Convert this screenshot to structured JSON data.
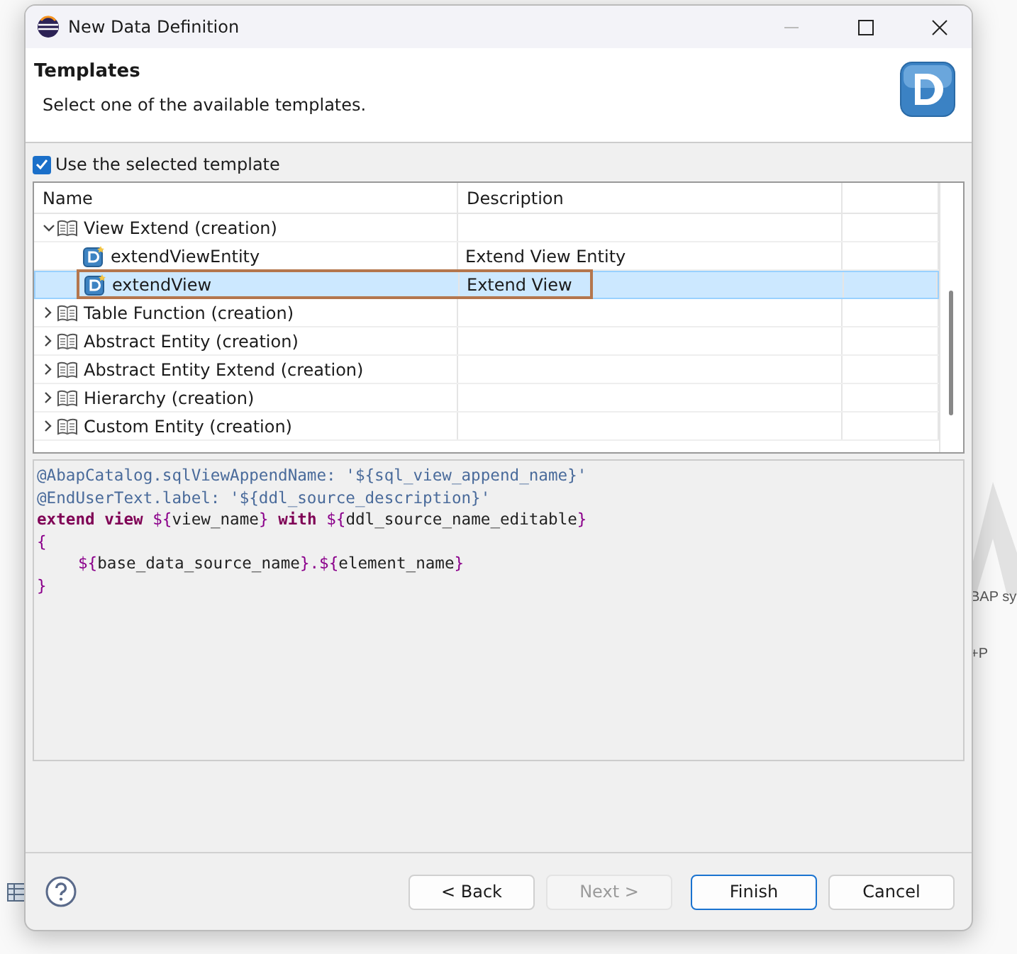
{
  "background": {
    "texts": [
      "BAP sy",
      "+P"
    ]
  },
  "window": {
    "title": "New Data Definition"
  },
  "header": {
    "title": "Templates",
    "description": "Select one of the available templates."
  },
  "use_template": {
    "label": "Use the selected template",
    "checked": true
  },
  "table": {
    "columns": [
      "Name",
      "Description"
    ],
    "rows": [
      {
        "kind": "folder",
        "name": "View Extend (creation)",
        "expanded": true,
        "selected": false,
        "children": [
          {
            "kind": "template",
            "name": "extendViewEntity",
            "description": "Extend View Entity",
            "selected": false,
            "boxed": false
          },
          {
            "kind": "template",
            "name": "extendView",
            "description": "Extend View",
            "selected": true,
            "boxed": true
          }
        ]
      },
      {
        "kind": "folder",
        "name": "Table Function (creation)",
        "expanded": false,
        "selected": false
      },
      {
        "kind": "folder",
        "name": "Abstract Entity (creation)",
        "expanded": false,
        "selected": false
      },
      {
        "kind": "folder",
        "name": "Abstract Entity Extend (creation)",
        "expanded": false,
        "selected": false
      },
      {
        "kind": "folder",
        "name": "Hierarchy (creation)",
        "expanded": false,
        "selected": false
      },
      {
        "kind": "folder",
        "name": "Custom Entity (creation)",
        "expanded": false,
        "selected": false
      }
    ]
  },
  "code": [
    {
      "indent": false,
      "tokens": [
        {
          "kind": "annotation",
          "text": "@AbapCatalog.sqlViewAppendName: '${sql_view_append_name}'"
        }
      ]
    },
    {
      "indent": false,
      "tokens": [
        {
          "kind": "annotation",
          "text": "@EndUserText.label: '${ddl_source_description}'"
        }
      ]
    },
    {
      "indent": false,
      "tokens": [
        {
          "kind": "keyword",
          "text": "extend view "
        },
        {
          "kind": "brace",
          "text": "${"
        },
        {
          "kind": "plain",
          "text": "view_name"
        },
        {
          "kind": "brace",
          "text": "}"
        },
        {
          "kind": "keyword",
          "text": " with "
        },
        {
          "kind": "brace",
          "text": "${"
        },
        {
          "kind": "plain",
          "text": "ddl_source_name_editable"
        },
        {
          "kind": "brace",
          "text": "}"
        }
      ]
    },
    {
      "indent": false,
      "tokens": [
        {
          "kind": "brace",
          "text": "{"
        }
      ]
    },
    {
      "indent": true,
      "tokens": [
        {
          "kind": "brace",
          "text": "${"
        },
        {
          "kind": "plain",
          "text": "base_data_source_name"
        },
        {
          "kind": "brace",
          "text": "}.${"
        },
        {
          "kind": "plain",
          "text": "element_name"
        },
        {
          "kind": "brace",
          "text": "}"
        }
      ]
    },
    {
      "indent": false,
      "tokens": [
        {
          "kind": "brace",
          "text": "}"
        }
      ]
    }
  ],
  "buttons": [
    {
      "label": "< Back",
      "disabled": false,
      "default": false
    },
    {
      "label": "Next >",
      "disabled": true,
      "default": false
    },
    {
      "label": "Finish",
      "disabled": false,
      "default": true
    },
    {
      "label": "Cancel",
      "disabled": false,
      "default": false
    }
  ]
}
